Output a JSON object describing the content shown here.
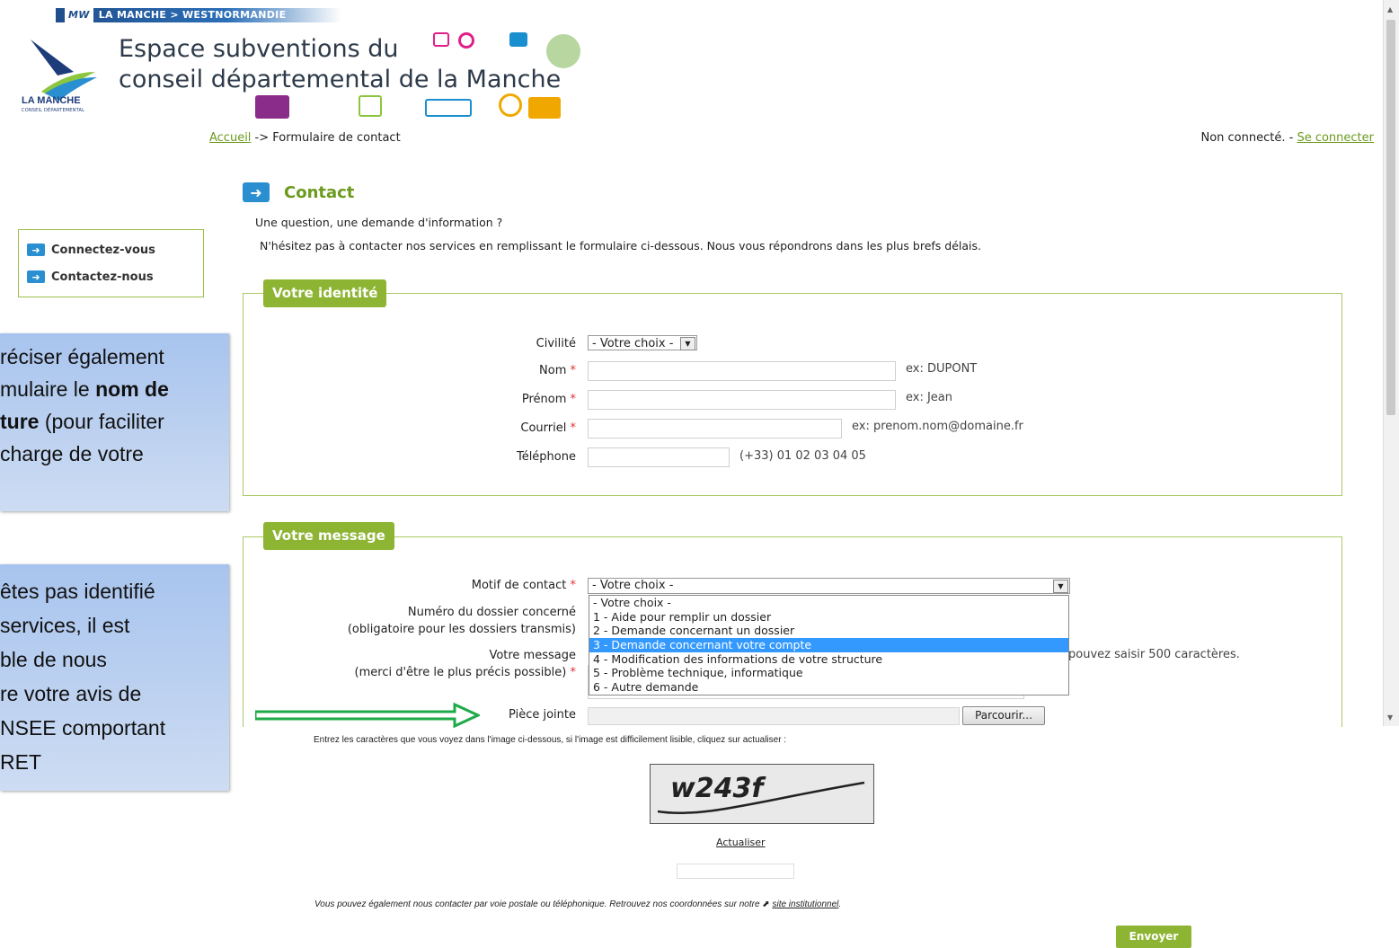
{
  "header": {
    "topbar_logo": "MW",
    "topbar_text": "LA MANCHE > WESTNORMANDIE",
    "logo_text": "LA MANCHE",
    "logo_sub": "CONSEIL DÉPARTEMENTAL",
    "title_line1": "Espace subventions du",
    "title_line2": "conseil départemental de la Manche"
  },
  "breadcrumb": {
    "home": "Accueil",
    "separator": " -> ",
    "current": "Formulaire de contact"
  },
  "connection": {
    "status": "Non connecté. - ",
    "login_link": "Se connecter"
  },
  "left_nav": {
    "items": [
      {
        "label": "Connectez-vous"
      },
      {
        "label": "Contactez-nous"
      }
    ]
  },
  "tooltip1": {
    "line1": "réciser également",
    "line2a": "mulaire le ",
    "line2b": "nom de",
    "line3a": "ture",
    "line3b": " (pour faciliter",
    "line4": "charge de votre"
  },
  "tooltip2": {
    "line1": "êtes  pas  identifié",
    "line2": "services,   il   est",
    "line3": "ble      de      nous",
    "line4": "re  votre  avis  de",
    "line5": "NSEE  comportant",
    "line6": "RET"
  },
  "contact": {
    "title": "Contact",
    "intro1": "Une question, une demande d'information ?",
    "intro2": "N'hésitez pas à contacter nos services en remplissant le formulaire ci-dessous. Nous vous répondrons dans les plus brefs délais."
  },
  "identity": {
    "legend": "Votre identité",
    "civilite_label": "Civilité",
    "civilite_value": "- Votre choix -",
    "nom_label": "Nom",
    "nom_hint": "ex: DUPONT",
    "prenom_label": "Prénom",
    "prenom_hint": "ex: Jean",
    "courriel_label": "Courriel",
    "courriel_hint": "ex: prenom.nom@domaine.fr",
    "telephone_label": "Téléphone",
    "telephone_hint": "(+33) 01 02 03 04 05",
    "required_mark": "*"
  },
  "message": {
    "legend": "Votre message",
    "motif_label": "Motif de contact",
    "motif_value": "- Votre choix -",
    "motif_options": [
      "- Votre choix -",
      "1 - Aide pour remplir un dossier",
      "2 - Demande concernant un dossier",
      "3 - Demande concernant votre compte",
      "4 - Modification des informations de votre structure",
      "5 - Problème technique, informatique",
      "6 - Autre demande"
    ],
    "motif_selected_index": 3,
    "dossier_label1": "Numéro du dossier concerné",
    "dossier_label2": "(obligatoire pour les dossiers transmis)",
    "msg_label1": "Votre message",
    "msg_label2": "(merci d'être le plus précis possible)",
    "char_hint": "pouvez saisir 500 caractères.",
    "piece_label": "Pièce jointe",
    "browse_label": "Parcourir..."
  },
  "captcha": {
    "instruction": "Entrez les caractères que vous voyez dans l'image ci-dessous, si l'image est difficilement lisible, cliquez sur actualiser :",
    "image_text": "w243f",
    "refresh_label": "Actualiser"
  },
  "footer": {
    "text": "Vous pouvez également nous contacter par voie postale ou téléphonique. Retrouvez nos coordonnées sur notre ",
    "link": "site institutionnel",
    "end": "."
  },
  "send_label": "Envoyer",
  "colors": {
    "accent_green": "#8db433",
    "link_green": "#6b9a1f",
    "nav_blue": "#2a8fd0",
    "selected_option": "#3399ff",
    "annotation_arrow": "#1faa4a"
  }
}
